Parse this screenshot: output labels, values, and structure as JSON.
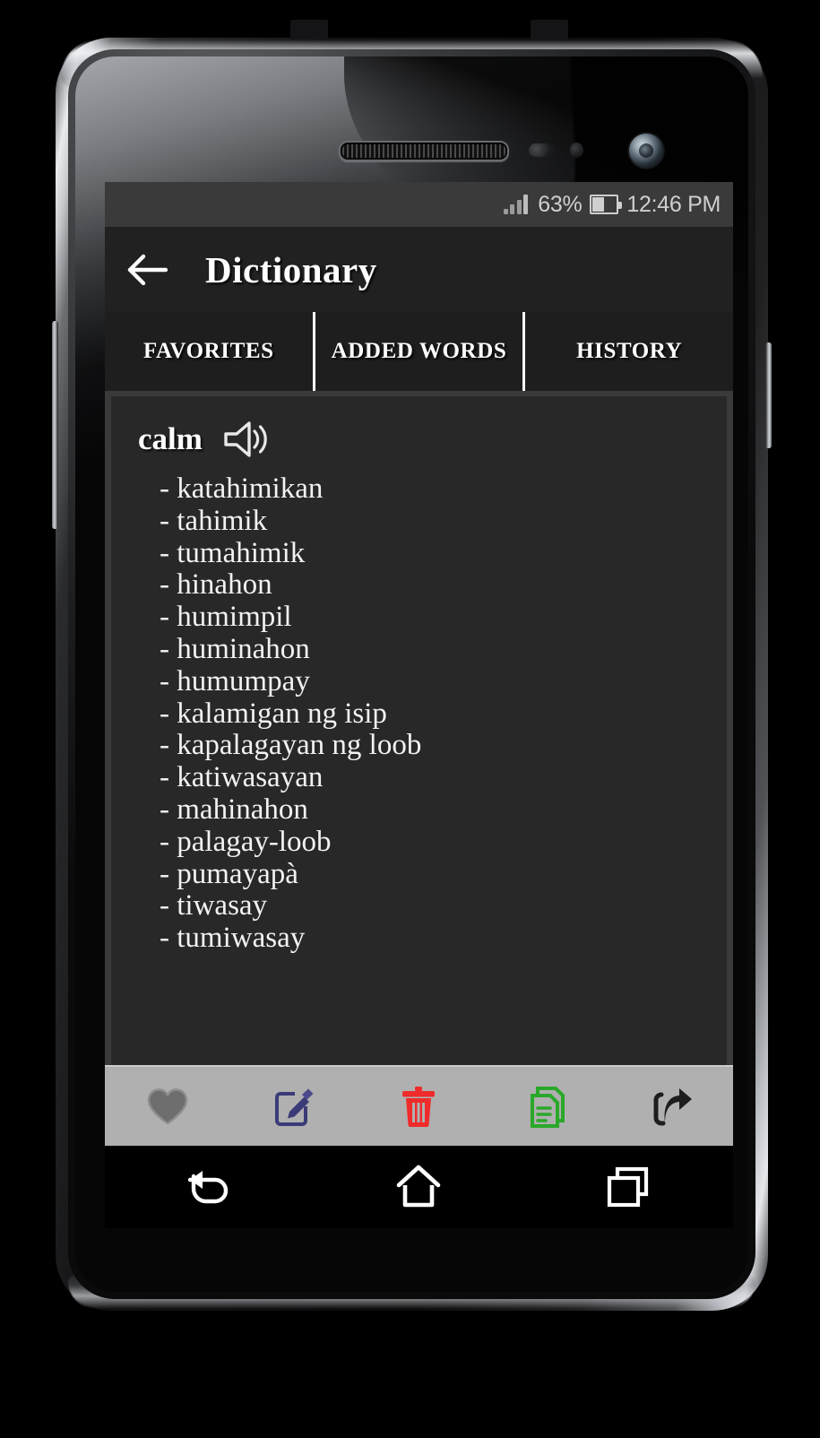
{
  "status_bar": {
    "battery_percent": "63%",
    "time": "12:46 PM",
    "signal_icon": "signal-bars-icon",
    "battery_icon": "battery-icon"
  },
  "action_bar": {
    "back_icon": "back-arrow-icon",
    "title": "Dictionary"
  },
  "tabs": [
    {
      "label": "FAVORITES",
      "selected": false
    },
    {
      "label": "ADDED WORDS",
      "selected": false
    },
    {
      "label": "HISTORY",
      "selected": false
    }
  ],
  "entry": {
    "headword": "calm",
    "speaker_icon": "speaker-icon",
    "definitions": [
      "katahimikan",
      "tahimik",
      "tumahimik",
      "hinahon",
      "humimpil",
      "huminahon",
      "humumpay",
      "kalamigan ng isip",
      "kapalagayan ng loob",
      "katiwasayan",
      "mahinahon",
      "palagay-loob",
      "pumayapà",
      "tiwasay",
      "tumiwasay"
    ]
  },
  "action_toolbar": [
    {
      "name": "favorite-button",
      "icon": "heart-icon",
      "color": "#6e6e6e"
    },
    {
      "name": "edit-button",
      "icon": "edit-pencil-icon",
      "color": "#3b3b78"
    },
    {
      "name": "delete-button",
      "icon": "trash-icon",
      "color": "#ef2b2b"
    },
    {
      "name": "copy-button",
      "icon": "copy-document-icon",
      "color": "#2aa82a"
    },
    {
      "name": "share-button",
      "icon": "share-arrow-icon",
      "color": "#1d1d1d"
    }
  ],
  "nav_bar": [
    {
      "name": "nav-back-button",
      "icon": "nav-back-icon"
    },
    {
      "name": "nav-home-button",
      "icon": "nav-home-icon"
    },
    {
      "name": "nav-recents-button",
      "icon": "nav-recents-icon"
    }
  ],
  "colors": {
    "status_bar_bg": "#3a3a3a",
    "action_bar_bg": "#212121",
    "tab_bar_bg": "#1e1e1e",
    "card_bg": "#282828",
    "toolbar_bg": "#b0b0b0",
    "nav_bg": "#000000",
    "text_primary": "#ffffff"
  }
}
